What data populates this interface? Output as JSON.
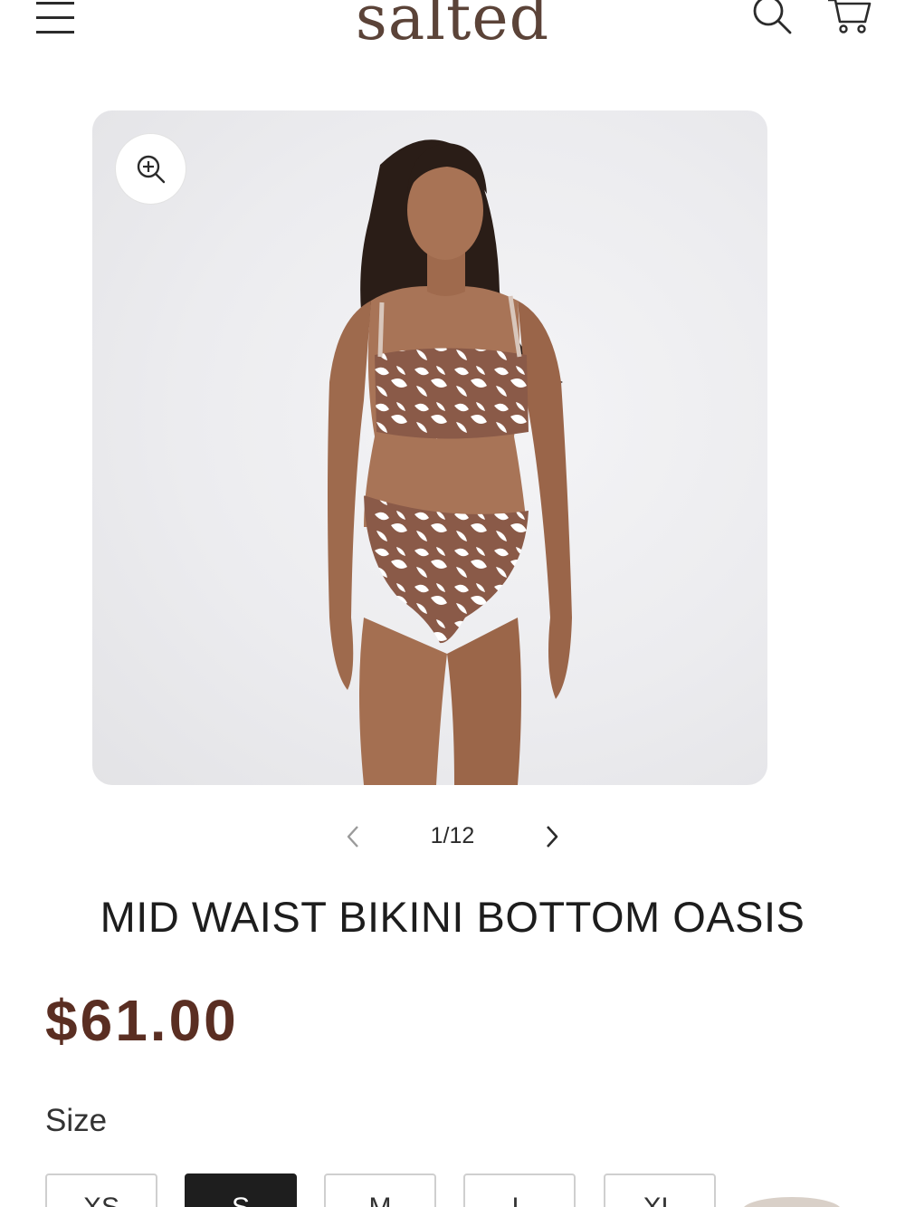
{
  "header": {
    "logo_text": "salted",
    "menu_icon": "hamburger-menu-icon",
    "search_icon": "search-icon",
    "cart_icon": "cart-icon"
  },
  "gallery": {
    "zoom_icon": "zoom-in-icon",
    "counter": "1/12",
    "prev_icon": "chevron-left-icon",
    "next_icon": "chevron-right-icon"
  },
  "product": {
    "title": "MID WAIST BIKINI BOTTOM OASIS",
    "price": "$61.00",
    "size_label": "Size",
    "sizes": [
      {
        "label": "XS",
        "selected": false
      },
      {
        "label": "S",
        "selected": true
      },
      {
        "label": "M",
        "selected": false
      },
      {
        "label": "L",
        "selected": false
      },
      {
        "label": "XL",
        "selected": false
      }
    ]
  },
  "colors": {
    "brand": "#5b4338",
    "price": "#5a2e22",
    "selected_size_bg": "#1e1e1e"
  }
}
